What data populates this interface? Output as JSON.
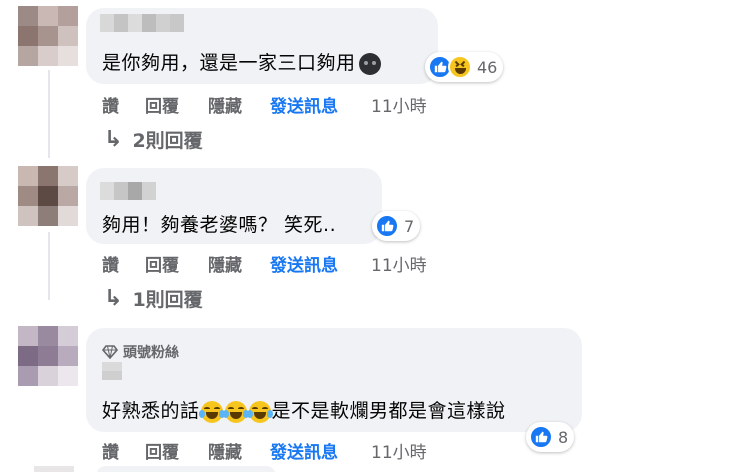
{
  "comments": [
    {
      "text": "是你夠用，還是一家三口夠用",
      "reaction_count": "46",
      "reactions": [
        "like-icon",
        "haha-icon"
      ],
      "actions": {
        "like": "讚",
        "reply": "回覆",
        "hide": "隱藏",
        "message": "發送訊息",
        "time": "11小時"
      },
      "replies_label": "2則回覆"
    },
    {
      "text": "夠用！夠養老婆嗎？ 笑死..",
      "reaction_count": "7",
      "reactions": [
        "like-icon"
      ],
      "actions": {
        "like": "讚",
        "reply": "回覆",
        "hide": "隱藏",
        "message": "發送訊息",
        "time": "11小時"
      },
      "replies_label": "1則回覆"
    },
    {
      "badge": "頭號粉絲",
      "text_before": "好熟悉的話",
      "text_after": "是不是軟爛男都是會這樣說",
      "reaction_count": "8",
      "reactions": [
        "like-icon"
      ],
      "actions": {
        "like": "讚",
        "reply": "回覆",
        "hide": "隱藏",
        "message": "發送訊息",
        "time": "11小時"
      }
    }
  ],
  "colors": {
    "bubble": "#f0f2f5",
    "link": "#1877f2",
    "muted": "#65676b",
    "like": "#1877f2"
  }
}
